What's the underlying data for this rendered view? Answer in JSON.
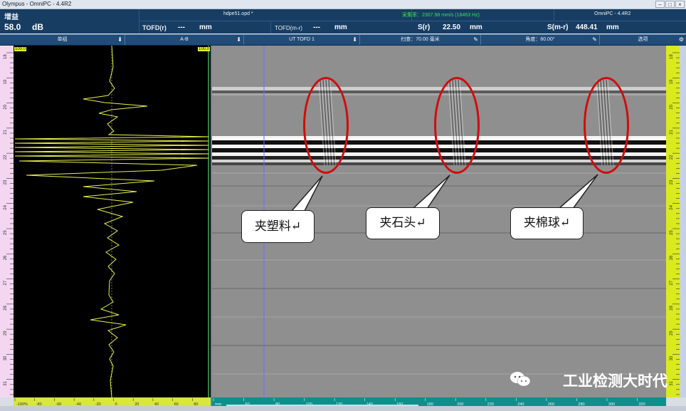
{
  "window": {
    "title": "Olympus - OmniPC - 4.4R2"
  },
  "readings": {
    "gain_label": "增益",
    "gain_value": "58.0",
    "gain_unit": "dB",
    "file_name": "hdpe51.opd *",
    "acq_rate": "采集率：2307.98 mm/s (18463 Hz)",
    "product": "OmniPC - 4.4R2",
    "tofd_r_label": "TOFD(r)",
    "tofd_r_value": "---",
    "tofd_r_unit": "mm",
    "tofd_mr_label": "TOFD(m-r)",
    "tofd_mr_value": "---",
    "tofd_mr_unit": "mm",
    "s_r_label": "S(r)",
    "s_r_value": "22.50",
    "s_r_unit": "mm",
    "s_mr_label": "S(m-r)",
    "s_mr_value": "448.41",
    "s_mr_unit": "mm"
  },
  "viewbar": {
    "v1": "单组",
    "v2": "A-B",
    "v3": "UT TOFD 1",
    "v4": "扫查：70.00 毫米",
    "v5": "角度：60.00°",
    "v6": "选项"
  },
  "gate": {
    "left_tag": "100.0",
    "right_tag": "100.0"
  },
  "ascan_ticks": [
    "18",
    "19",
    "20",
    "21",
    "22",
    "23",
    "24",
    "25",
    "26",
    "27",
    "28",
    "29",
    "30",
    "31"
  ],
  "ascan_x_ticks": [
    "-100%",
    "-80",
    "-60",
    "-40",
    "-20",
    "0",
    "20",
    "40",
    "60",
    "80"
  ],
  "bscan_x_ticks": [
    "mm",
    "60",
    "80",
    "100",
    "120",
    "140",
    "160",
    "180",
    "200",
    "220",
    "240",
    "260",
    "280",
    "300",
    "320"
  ],
  "right_ticks": [
    "18",
    "19",
    "20",
    "21",
    "22",
    "23",
    "24",
    "25",
    "26",
    "27",
    "28",
    "29",
    "30",
    "31"
  ],
  "callouts": [
    {
      "text": "夹塑料↵"
    },
    {
      "text": "夹石头↵"
    },
    {
      "text": "夹棉球↵"
    }
  ],
  "brand": {
    "text": "工业检测大时代"
  },
  "colors": {
    "header": "#173d63",
    "defect_ring": "#d00c0c",
    "ascan_trace": "#e8f04a"
  }
}
